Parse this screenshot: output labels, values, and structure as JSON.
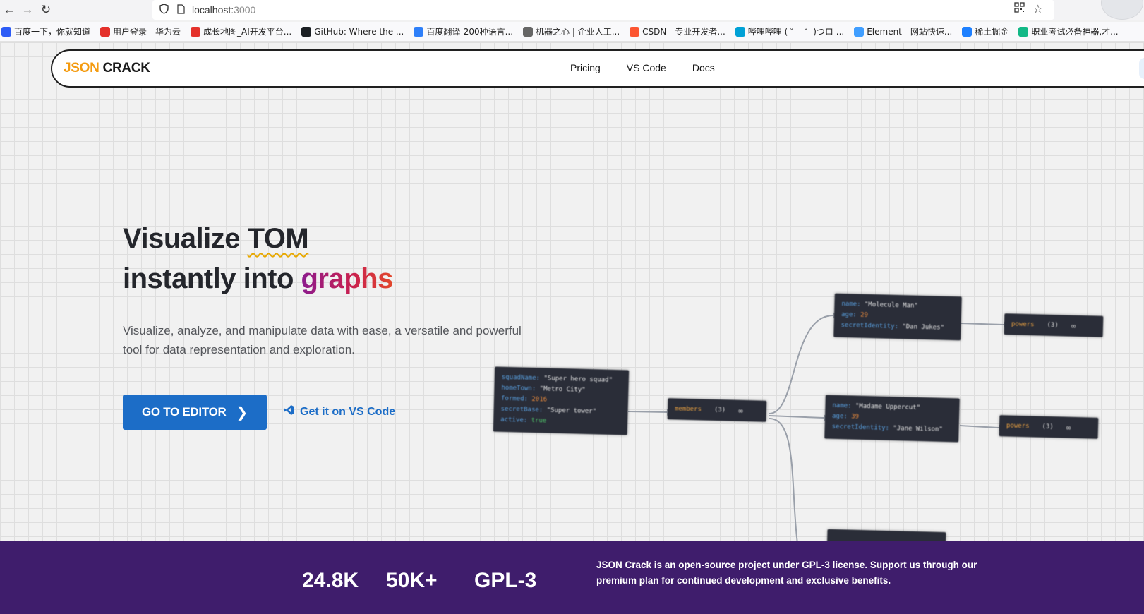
{
  "browser": {
    "url_host": "localhost:",
    "url_port": "3000",
    "bookmarks": [
      {
        "label": "百度一下，你就知道",
        "color": "#2d5cf6"
      },
      {
        "label": "用户登录—华为云",
        "color": "#e4312b"
      },
      {
        "label": "成长地图_AI开发平台...",
        "color": "#e4312b"
      },
      {
        "label": "GitHub: Where the ...",
        "color": "#1b1f23"
      },
      {
        "label": "百度翻译-200种语言...",
        "color": "#2d7ff9"
      },
      {
        "label": "机器之心 | 企业人工...",
        "color": "#666666"
      },
      {
        "label": "CSDN - 专业开发者...",
        "color": "#fc5531"
      },
      {
        "label": "哔哩哔哩 ( ゜- ゜)つロ ...",
        "color": "#00a1d6"
      },
      {
        "label": "Element - 网站快速...",
        "color": "#409eff"
      },
      {
        "label": "稀土掘金",
        "color": "#1e80ff"
      },
      {
        "label": "职业考试必备神器,才...",
        "color": "#12b886"
      }
    ]
  },
  "header": {
    "logo_json": "JSON",
    "logo_crack": "CRACK",
    "nav": [
      "Pricing",
      "VS Code",
      "Docs"
    ]
  },
  "hero": {
    "title_pre": "Visualize ",
    "title_tom": "TOM",
    "title_line2_pre": "instantly into ",
    "title_graphs": "graphs",
    "description": "Visualize, analyze, and manipulate data with ease, a versatile and powerful tool for data representation and exploration.",
    "cta_label": "GO TO EDITOR",
    "vscode_label": "Get it on VS Code"
  },
  "graph": {
    "root": [
      {
        "k": "squadName: ",
        "v": "\"Super hero squad\"",
        "t": "s"
      },
      {
        "k": "homeTown: ",
        "v": "\"Metro City\"",
        "t": "s"
      },
      {
        "k": "formed: ",
        "v": "2016",
        "t": "n"
      },
      {
        "k": "secretBase: ",
        "v": "\"Super tower\"",
        "t": "s"
      },
      {
        "k": "active: ",
        "v": "true",
        "t": "b"
      }
    ],
    "members": {
      "label": "members",
      "count": "(3)"
    },
    "member1": [
      {
        "k": "name: ",
        "v": "\"Molecule Man\"",
        "t": "s"
      },
      {
        "k": "age: ",
        "v": "29",
        "t": "n"
      },
      {
        "k": "secretIdentity: ",
        "v": "\"Dan Jukes\"",
        "t": "s"
      }
    ],
    "member2": [
      {
        "k": "name: ",
        "v": "\"Madame Uppercut\"",
        "t": "s"
      },
      {
        "k": "age: ",
        "v": "39",
        "t": "n"
      },
      {
        "k": "secretIdentity: ",
        "v": "\"Jane Wilson\"",
        "t": "s"
      }
    ],
    "powers1": {
      "label": "powers",
      "count": "(3)"
    },
    "powers2": {
      "label": "powers",
      "count": "(3)"
    }
  },
  "footer": {
    "stat1": "24.8K",
    "stat2": "50K+",
    "stat3": "GPL-3",
    "text": "JSON Crack is an open-source project under GPL-3 license. Support us through our premium plan for continued development and exclusive benefits."
  }
}
